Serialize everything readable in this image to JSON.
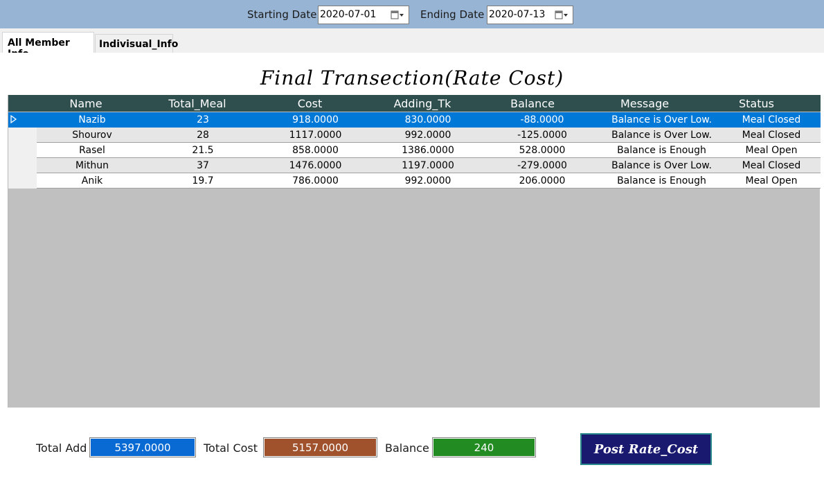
{
  "filters": {
    "start_label": "Starting Date",
    "start_value": "2020-07-01",
    "end_label": "Ending Date",
    "end_value": "2020-07-13"
  },
  "tabs": [
    {
      "label": "All Member Info"
    },
    {
      "label": "Indivisual_Info"
    }
  ],
  "heading": "Final Transection(Rate Cost)",
  "grid": {
    "columns": [
      "Name",
      "Total_Meal",
      "Cost",
      "Adding_Tk",
      "Balance",
      "Message",
      "Status"
    ],
    "rows": [
      [
        "Nazib",
        "23",
        "918.0000",
        "830.0000",
        "-88.0000",
        "Balance is Over Low.",
        "Meal Closed"
      ],
      [
        "Shourov",
        "28",
        "1117.0000",
        "992.0000",
        "-125.0000",
        "Balance is Over Low.",
        "Meal Closed"
      ],
      [
        "Rasel",
        "21.5",
        "858.0000",
        "1386.0000",
        "528.0000",
        "Balance is Enough",
        "Meal Open"
      ],
      [
        "Mithun",
        "37",
        "1476.0000",
        "1197.0000",
        "-279.0000",
        "Balance is Over Low.",
        "Meal Closed"
      ],
      [
        "Anik",
        "19.7",
        "786.0000",
        "992.0000",
        "206.0000",
        "Balance is Enough",
        "Meal Open"
      ]
    ],
    "selected_row": 0
  },
  "footer": {
    "total_add_label": "Total Add",
    "total_add_value": "5397.0000",
    "total_cost_label": "Total Cost",
    "total_cost_value": "5157.0000",
    "balance_label": "Balance",
    "balance_value": "240",
    "post_button": "Post Rate_Cost"
  },
  "colors": {
    "total_add": "#0a6ad4",
    "total_cost": "#a0522d",
    "balance": "#228b22",
    "post_button": "#191970",
    "header": "#2f4f4f",
    "selection": "#0078d7"
  }
}
